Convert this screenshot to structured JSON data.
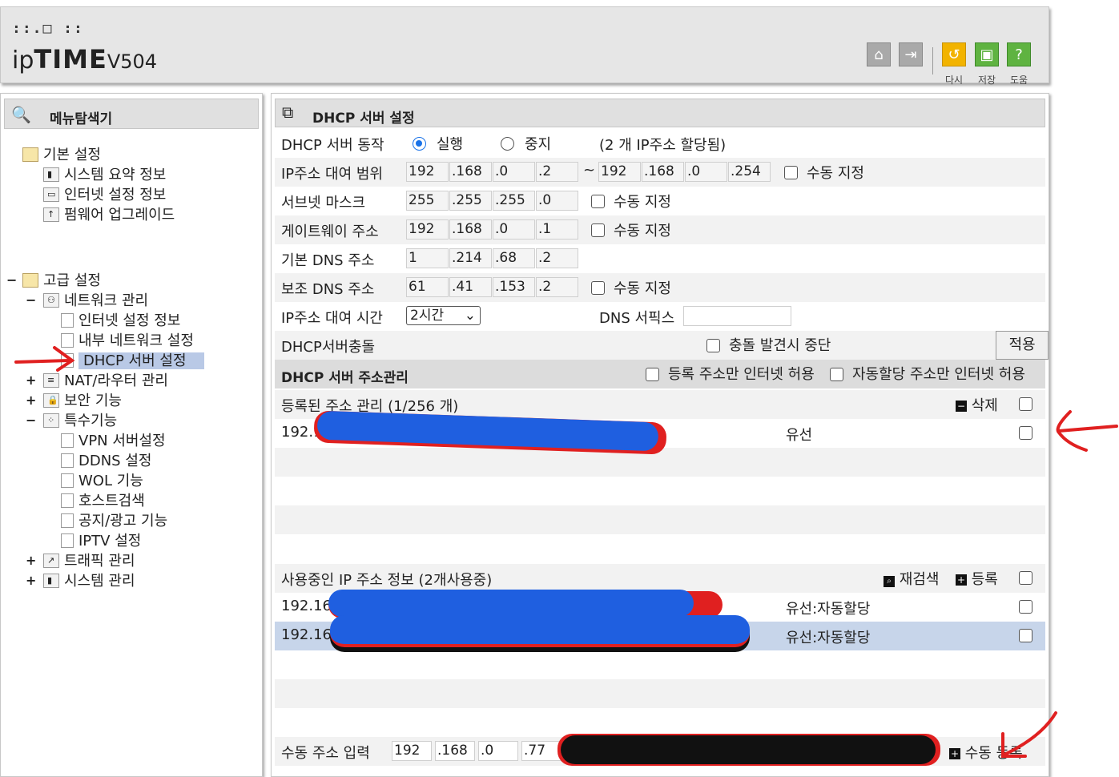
{
  "header": {
    "logo_dots": "::.□ ::",
    "logo_ip": "ip",
    "logo_time": "TIME",
    "logo_version": "V504",
    "buttons": [
      {
        "icon": "home-icon",
        "label": ""
      },
      {
        "icon": "logout-icon",
        "label": ""
      },
      {
        "icon": "undo-icon",
        "label": "다시"
      },
      {
        "icon": "save-icon",
        "label": "저장"
      },
      {
        "icon": "help-icon",
        "label": "도움"
      }
    ]
  },
  "sidebar": {
    "title": "메뉴탐색기",
    "items": [
      {
        "label": "기본 설정",
        "level": 0
      },
      {
        "label": "시스템 요약 정보",
        "level": 1
      },
      {
        "label": "인터넷 설정 정보",
        "level": 1
      },
      {
        "label": "펌웨어 업그레이드",
        "level": 1
      },
      {
        "label": "고급 설정",
        "level": 0,
        "toggle": "−"
      },
      {
        "label": "네트워크 관리",
        "level": 1,
        "toggle": "−"
      },
      {
        "label": "인터넷 설정 정보",
        "level": 2
      },
      {
        "label": "내부 네트워크 설정",
        "level": 2
      },
      {
        "label": "DHCP 서버 설정",
        "level": 2,
        "selected": true
      },
      {
        "label": "NAT/라우터 관리",
        "level": 1,
        "toggle": "+"
      },
      {
        "label": "보안 기능",
        "level": 1,
        "toggle": "+"
      },
      {
        "label": "특수기능",
        "level": 1,
        "toggle": "−"
      },
      {
        "label": "VPN 서버설정",
        "level": 2
      },
      {
        "label": "DDNS 설정",
        "level": 2
      },
      {
        "label": "WOL 기능",
        "level": 2
      },
      {
        "label": "호스트검색",
        "level": 2
      },
      {
        "label": "공지/광고 기능",
        "level": 2
      },
      {
        "label": "IPTV 설정",
        "level": 2
      },
      {
        "label": "트래픽 관리",
        "level": 1,
        "toggle": "+"
      },
      {
        "label": "시스템 관리",
        "level": 1,
        "toggle": "+"
      }
    ]
  },
  "main": {
    "title": "DHCP 서버 설정",
    "dhcp_server": {
      "label": "DHCP 서버 동작",
      "run_label": "실행",
      "stop_label": "중지",
      "selected": "실행",
      "assigned_note": "(2 개 IP주소 할당됨)"
    },
    "ip_range": {
      "label": "IP주소 대여 범위",
      "start": [
        "192",
        ".168",
        ".0",
        ".2"
      ],
      "tilde": "~",
      "end": [
        "192",
        ".168",
        ".0",
        ".254"
      ],
      "manual_label": "수동 지정"
    },
    "subnet": {
      "label": "서브넷 마스크",
      "value": [
        "255",
        ".255",
        ".255",
        ".0"
      ],
      "manual_label": "수동 지정"
    },
    "gateway": {
      "label": "게이트웨이 주소",
      "value": [
        "192",
        ".168",
        ".0",
        ".1"
      ],
      "manual_label": "수동 지정"
    },
    "primary_dns": {
      "label": "기본 DNS 주소",
      "value": [
        "1",
        ".214",
        ".68",
        ".2"
      ]
    },
    "secondary_dns": {
      "label": "보조 DNS 주소",
      "value": [
        "61",
        ".41",
        ".153",
        ".2"
      ],
      "manual_label": "수동 지정"
    },
    "lease_time": {
      "label": "IP주소 대여 시간",
      "value": "2시간",
      "dns_suffix_label": "DNS 서픽스",
      "dns_suffix_value": ""
    },
    "conflict": {
      "label": "DHCP서버충돌",
      "stop_label": "충돌 발견시 중단",
      "apply_label": "적용"
    },
    "address_mgmt": {
      "title": "DHCP 서버 주소관리",
      "registered_only_label": "등록 주소만 인터넷 허용",
      "auto_only_label": "자동할당 주소만 인터넷 허용"
    },
    "registered": {
      "title": "등록된 주소 관리 (1/256 개)",
      "delete_label": "삭제",
      "rows": [
        {
          "ip": "192.1",
          "type": "유선"
        }
      ]
    },
    "in_use": {
      "title": "사용중인 IP 주소 정보 (2개사용중)",
      "rescan_label": "재검색",
      "register_label": "등록",
      "rows": [
        {
          "ip": "192.168",
          "type": "유선:자동할당"
        },
        {
          "ip": "192.168",
          "type": "유선:자동할당"
        }
      ]
    },
    "manual_input": {
      "label": "수동 주소 입력",
      "value": [
        "192",
        ".168",
        ".0",
        ".77"
      ],
      "register_label": "수동 등록"
    }
  },
  "colors": {
    "selection": "#b9c9e6",
    "row_selected": "#c7d5ea",
    "radio": "#1a73e8",
    "annotation_red": "#e02020",
    "scribble_blue": "#1f5fe0"
  }
}
